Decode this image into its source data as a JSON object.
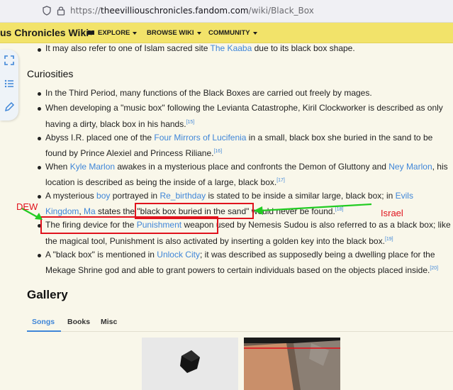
{
  "browser": {
    "url_prefix": "https://",
    "url_domain": "theevilliouschronicles.fandom.com",
    "url_path": "/wiki/Black_Box"
  },
  "wiki": {
    "title": "us Chronicles Wiki",
    "nav": [
      {
        "label": "EXPLORE",
        "icon": "book-icon"
      },
      {
        "label": "BROWSE WIKI"
      },
      {
        "label": "COMMUNITY"
      }
    ]
  },
  "rail": {
    "icons": [
      "expand-icon",
      "list-icon",
      "pencil-icon"
    ]
  },
  "article": {
    "top_bullet": {
      "pre": "It may also refer to one of Islam sacred site ",
      "link": "The Kaaba",
      "post": " due to its black box shape."
    },
    "curiosities_heading": "Curiosities",
    "b1": "In the Third Period, many functions of the Black Boxes are carried out freely by mages.",
    "b2_l1": "When developing a \"music box\" following the Levianta Catastrophe, Kiril Clockworker is described as only",
    "b2_l2": "having a dirty, black box in his hands.",
    "b2_ref": "[15]",
    "b3_l1_pre": "Abyss I.R. placed one of the ",
    "b3_l1_link": "Four Mirrors of Lucifenia",
    "b3_l1_post": " in a small, black box she buried in the sand to be",
    "b3_l2": "found by Prince Alexiel and Princess Riliane.",
    "b3_ref": "[16]",
    "b4_l1_pre": "When ",
    "b4_l1_link1": "Kyle Marlon",
    "b4_l1_mid": " awakes in a mysterious place and confronts the Demon of Gluttony and ",
    "b4_l1_link2": "Ney Marlon",
    "b4_l1_post": ", his",
    "b4_l2": "location is described as being the inside of a large, black box.",
    "b4_ref": "[17]",
    "b5_l1_pre": "A mysterious ",
    "b5_l1_link1": "boy",
    "b5_l1_mid1": " portrayed in ",
    "b5_l1_link2": "Re_birthday",
    "b5_l1_mid2": " is stated to be inside a similar large, black box; in ",
    "b5_l1_link3": "Evils",
    "b5_l2_link1": "Kingdom",
    "b5_l2_sep": ", ",
    "b5_l2_link2": "Ma",
    "b5_l2_mid": " states the ",
    "b5_l2_quote": "\"black box buried in the sand\"",
    "b5_l2_post": " would never be found.",
    "b5_ref": "[18]",
    "b6_l1_pre": "The firing device for the ",
    "b6_l1_link": "Punishment",
    "b6_l1_post1": " weapon",
    "b6_l1_post2": " used by Nemesis Sudou is also referred to as a black box; like",
    "b6_l2": "the magical tool, Punishment is also activated by inserting a golden key into the black box.",
    "b6_ref": "[19]",
    "b7_l1_pre": "A \"black box\" is mentioned in ",
    "b7_l1_link": "Unlock City",
    "b7_l1_post": "; it was described as supposedly being a dwelling place for the",
    "b7_l2": "Mekage Shrine god and able to grant powers to certain individuals based on the objects placed inside.",
    "b7_ref": "[20]",
    "gallery_heading": "Gallery",
    "tabs": [
      "Songs",
      "Books",
      "Misc"
    ]
  },
  "annotations": {
    "left_label": "DEW",
    "right_label": "Israel",
    "colors": {
      "red": "#e0131d",
      "green": "#22cc22"
    }
  }
}
